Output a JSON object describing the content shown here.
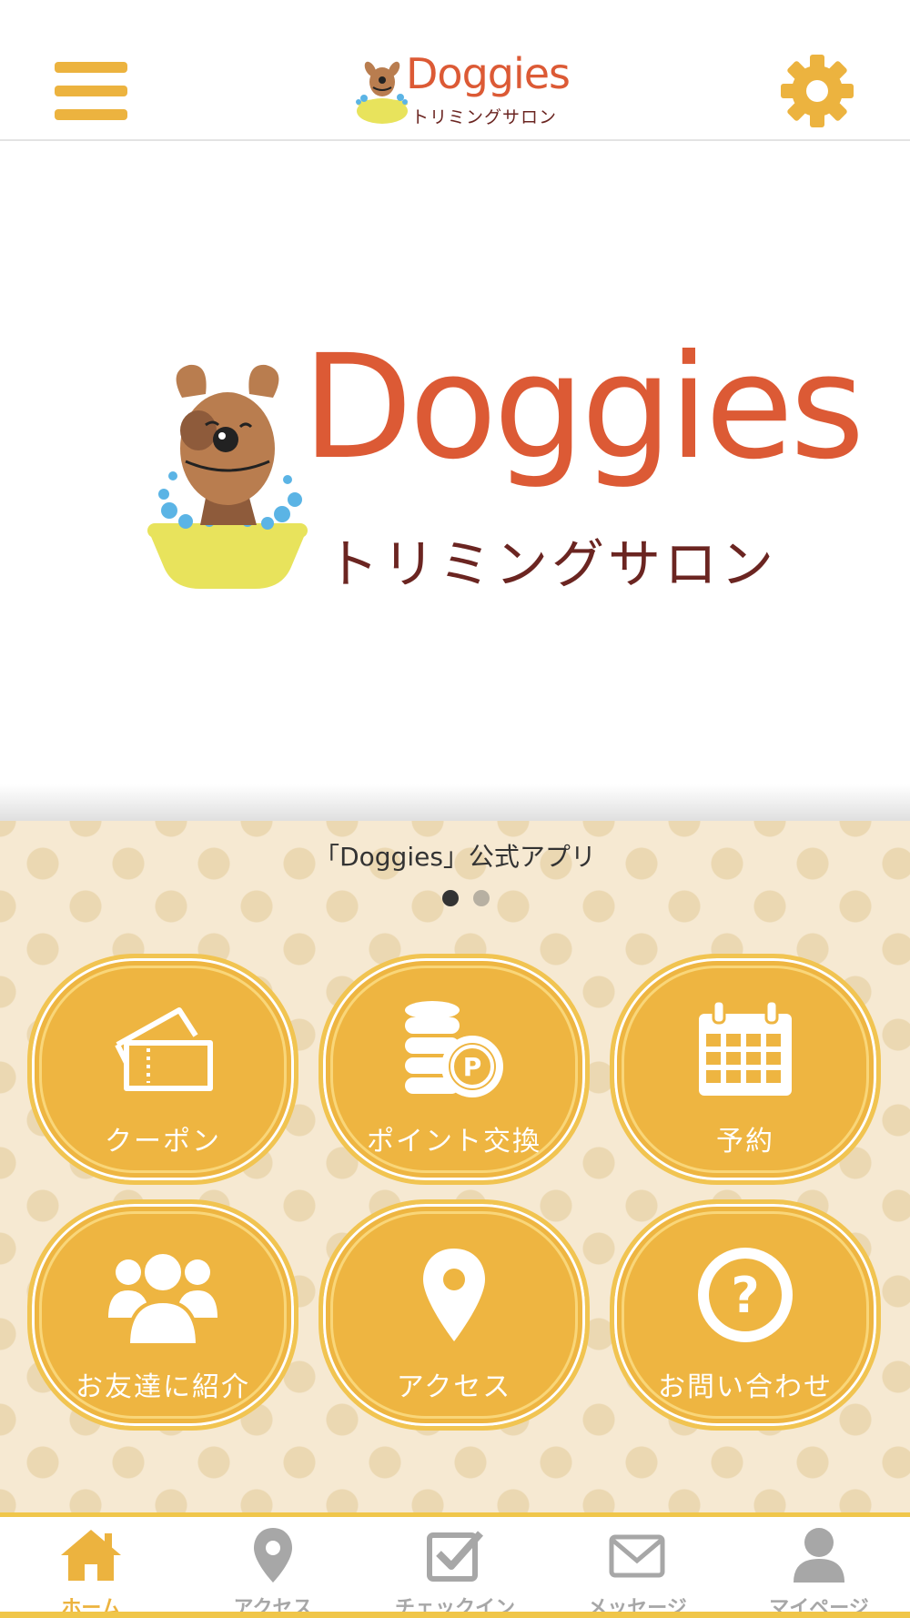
{
  "header": {
    "logo_text": "Doggies",
    "logo_subtitle": "トリミングサロン",
    "menu_icon": "hamburger-menu-icon",
    "settings_icon": "gear-icon"
  },
  "hero": {
    "logo_text": "Doggies",
    "logo_subtitle": "トリミングサロン"
  },
  "caption": "「Doggies」公式アプリ",
  "carousel": {
    "page_count": 2,
    "active_index": 0
  },
  "tiles": [
    {
      "label": "クーポン",
      "icon": "coupon-ticket-icon"
    },
    {
      "label": "ポイント交換",
      "icon": "point-coins-icon"
    },
    {
      "label": "予約",
      "icon": "calendar-icon"
    },
    {
      "label": "お友達に紹介",
      "icon": "friends-group-icon"
    },
    {
      "label": "アクセス",
      "icon": "map-pin-icon"
    },
    {
      "label": "お問い合わせ",
      "icon": "question-circle-icon"
    }
  ],
  "tabbar": [
    {
      "label": "ホーム",
      "icon": "home-icon",
      "active": true
    },
    {
      "label": "アクセス",
      "icon": "map-pin-icon",
      "active": false
    },
    {
      "label": "チェックイン",
      "icon": "checkin-checkbox-icon",
      "active": false
    },
    {
      "label": "メッセージ",
      "icon": "envelope-icon",
      "active": false
    },
    {
      "label": "マイページ",
      "icon": "user-icon",
      "active": false
    }
  ],
  "colors": {
    "accent": "#ECB33F",
    "logo_orange": "#DC5A35",
    "logo_brown": "#6b2521",
    "pattern_bg": "#F6E9D2",
    "inactive_tab": "#a7a7a7"
  }
}
